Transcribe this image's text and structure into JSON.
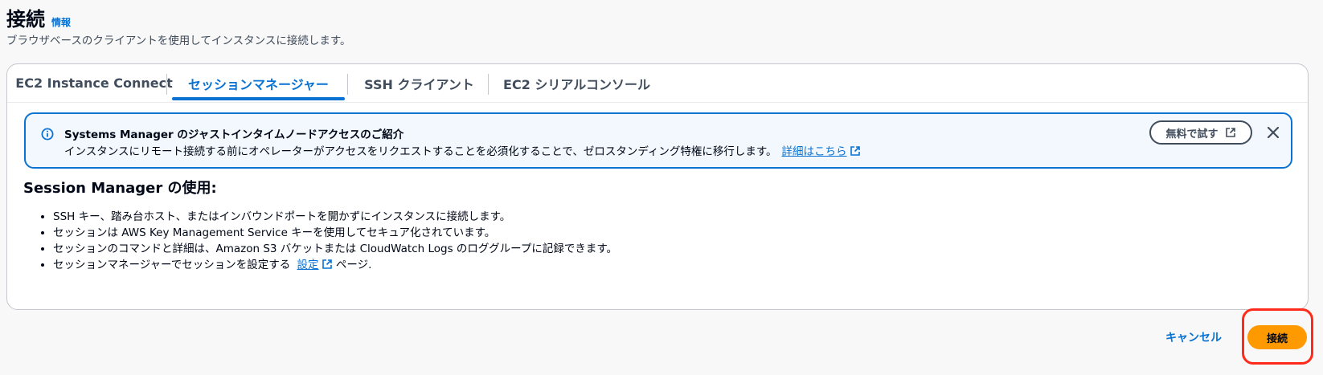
{
  "header": {
    "title": "接続",
    "info_link": "情報",
    "subtitle": "ブラウザベースのクライアントを使用してインスタンスに接続します。"
  },
  "tabs": [
    {
      "label": "EC2 Instance Connect",
      "active": false
    },
    {
      "label": "セッションマネージャー",
      "active": true
    },
    {
      "label": "SSH クライアント",
      "active": false
    },
    {
      "label": "EC2 シリアルコンソール",
      "active": false
    }
  ],
  "alert": {
    "icon": "info-icon",
    "title": "Systems Manager のジャストインタイムノードアクセスのご紹介",
    "body": "インスタンスにリモート接続する前にオペレーターがアクセスをリクエストすることを必須化することで、ゼロスタンディング特権に移行します。",
    "learn_more_link": "詳細はこちら",
    "try_button": "無料で試す",
    "close_icon": "close-icon"
  },
  "section": {
    "title": "Session Manager の使用:",
    "bullets": [
      "SSH キー、踏み台ホスト、またはインバウンドポートを開かずにインスタンスに接続します。",
      "セッションは AWS Key Management Service キーを使用してセキュア化されています。",
      "セッションのコマンドと詳細は、Amazon S3 バケットまたは CloudWatch Logs のロググループに記録できます。"
    ],
    "last_bullet_prefix": "セッションマネージャーでセッションを設定する",
    "last_bullet_link": "設定",
    "last_bullet_suffix": "ページ."
  },
  "footer": {
    "cancel_label": "キャンセル",
    "connect_label": "接続"
  },
  "colors": {
    "accent": "#0972d3",
    "primary_button": "#ff9900",
    "highlight": "#ff2a1a"
  }
}
